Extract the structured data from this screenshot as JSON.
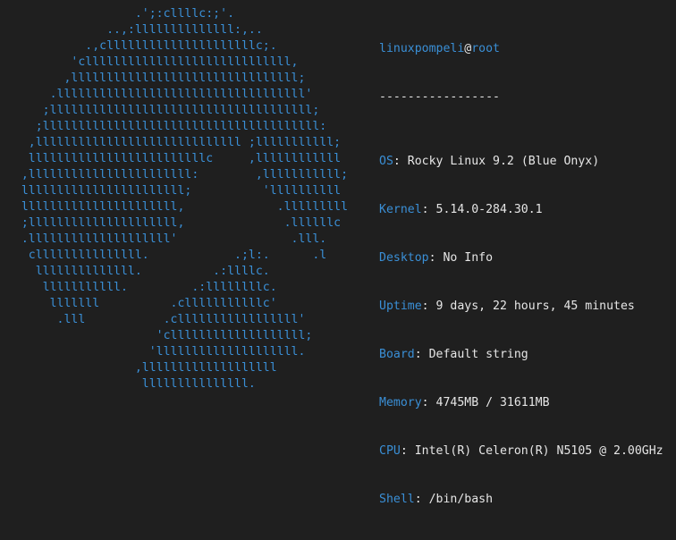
{
  "colors": {
    "background": "#1f1f1f",
    "accent": "#3a8fd6",
    "text": "#e6e6e6"
  },
  "logo_lines": [
    "                   .';:cllllc:;'.",
    "               ..,:llllllllllllll:,..",
    "            .,clllllllllllllllllllllc;.",
    "          'clllllllllllllllllllllllllllll,",
    "         ,llllllllllllllllllllllllllllllll;",
    "       .lllllllllllllllllllllllllllllllllll'",
    "      ;lllllllllllllllllllllllllllllllllllll;",
    "     ;lllllllllllllllllllllllllllllllllllllll:",
    "    ,lllllllllllllllllllllllllllll ;lllllllllll;",
    "    lllllllllllllllllllllllllc     ,llllllllllll",
    "   ,lllllllllllllllllllllll:        ,lllllllllll;",
    "   lllllllllllllllllllllll;          'llllllllll",
    "   llllllllllllllllllllll,             .lllllllll",
    "   ;lllllllllllllllllllll,              .llllllc",
    "   .llllllllllllllllllll'                .lll.",
    "    clllllllllllllll.            .;l:.      .l",
    "     llllllllllllll.          .:llllc.",
    "      lllllllllll.         .:llllllllc.",
    "       lllllll          .clllllllllllc'",
    "        .lll           .clllllllllllllllll'",
    "                      'clllllllllllllllllll;",
    "                     'llllllllllllllllllll.",
    "                   ,lllllllllllllllllll",
    "                    lllllllllllllll."
  ],
  "info": {
    "user": "linuxpompeli",
    "at": "@",
    "host": "root",
    "separator": "-----------------",
    "rows": [
      {
        "key": "OS",
        "value": "Rocky Linux 9.2 (Blue Onyx)"
      },
      {
        "key": "Kernel",
        "value": "5.14.0-284.30.1"
      },
      {
        "key": "Desktop",
        "value": "No Info"
      },
      {
        "key": "Uptime",
        "value": "9 days, 22 hours, 45 minutes"
      },
      {
        "key": "Board",
        "value": "Default string"
      },
      {
        "key": "Memory",
        "value": "4745MB / 31611MB"
      },
      {
        "key": "CPU",
        "value": "Intel(R) Celeron(R) N5105 @ 2.00GHz"
      },
      {
        "key": "Shell",
        "value": "/bin/bash"
      }
    ],
    "colon": ": "
  }
}
